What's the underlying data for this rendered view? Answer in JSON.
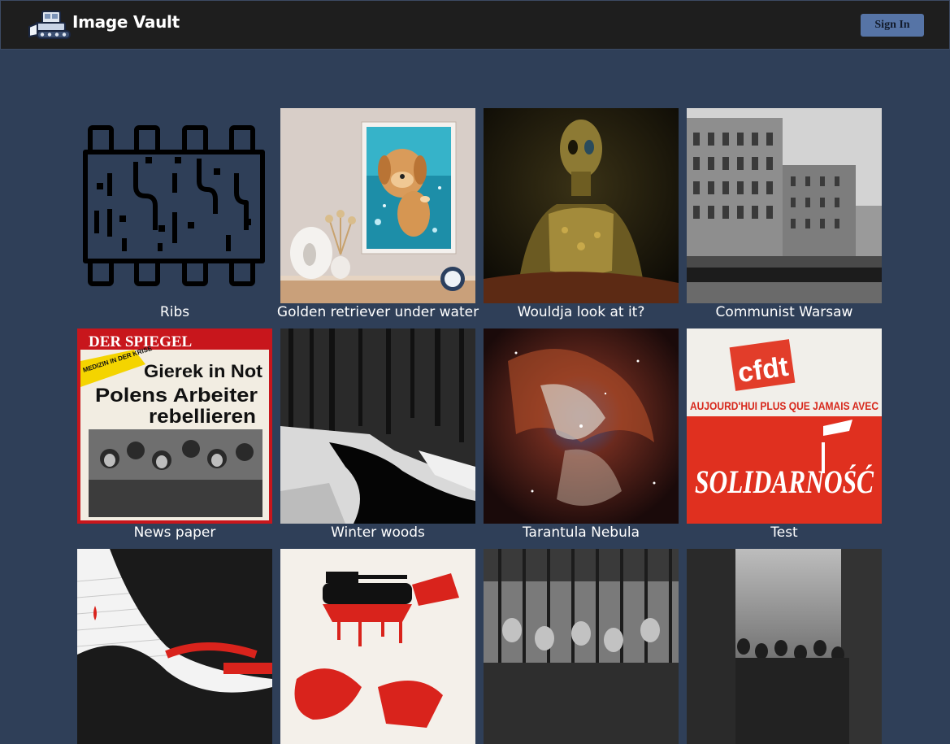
{
  "header": {
    "brand": "Image Vault",
    "sign_in_label": "Sign In",
    "logo_icon": "snowplow-logo-icon"
  },
  "gallery": {
    "items": [
      {
        "caption": "Ribs"
      },
      {
        "caption": "Golden retriever under water"
      },
      {
        "caption": "Wouldja look at it?"
      },
      {
        "caption": "Communist Warsaw"
      },
      {
        "caption": "News paper",
        "magazine_title": "DER SPIEGEL",
        "headline_1": "Gierek in Not",
        "headline_2": "Polens Arbeiter",
        "headline_3": "rebellieren",
        "banner": "MEDIZIN IN DER KRISE"
      },
      {
        "caption": "Winter woods"
      },
      {
        "caption": "Tarantula Nebula"
      },
      {
        "caption": "Test",
        "logo_text": "cfdt",
        "slogan": "AUJOURD'HUI PLUS QUE JAMAIS AVEC",
        "brand_text": "SOLIDARNOŚĆ"
      },
      {
        "caption": ""
      },
      {
        "caption": ""
      },
      {
        "caption": ""
      },
      {
        "caption": ""
      }
    ]
  },
  "colors": {
    "background": "#2f3f58",
    "header": "#1e1e1e",
    "button": "#5674a6"
  }
}
